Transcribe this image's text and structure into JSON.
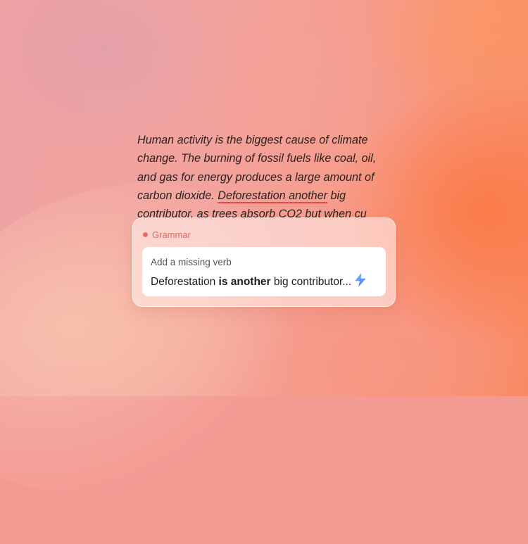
{
  "paragraph": {
    "before_flag": "Human activity is the biggest cause of climate change. The burning of fossil fuels like coal, oil, and gas for energy produces a large amount of carbon dioxide.",
    "flagged": "Deforestation another",
    "after_flag": "big contributor, as trees absorb CO2 but when cu"
  },
  "card": {
    "category": "Grammar",
    "suggestion": {
      "label": "Add a missing verb",
      "prefix": "Deforestation",
      "emphasis": "is another",
      "suffix": "big contributor..."
    }
  },
  "colors": {
    "accent": "#e8675e",
    "underline": "#e5484d",
    "bolt": "#4f86f7"
  },
  "icons": {
    "category_dot": "dot-icon",
    "apply": "lightning-bolt-icon"
  }
}
